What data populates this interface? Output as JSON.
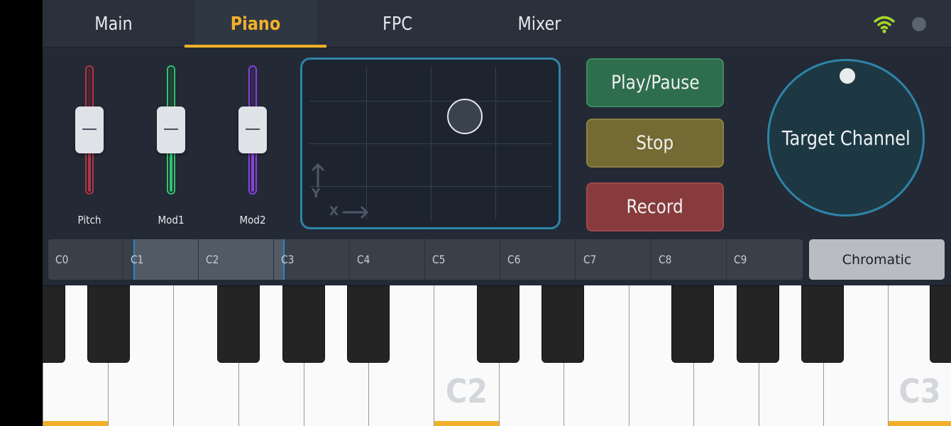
{
  "tabs": [
    {
      "label": "Main",
      "active": false
    },
    {
      "label": "Piano",
      "active": true
    },
    {
      "label": "FPC",
      "active": false
    },
    {
      "label": "Mixer",
      "active": false
    }
  ],
  "status": {
    "wifi_icon": "wifi-icon",
    "wifi_color": "#a6d629",
    "indicator_color": "#5b6270"
  },
  "faders": [
    {
      "label": "Pitch",
      "color": "#b53344",
      "level": 0.5
    },
    {
      "label": "Mod1",
      "color": "#2ec46d",
      "level": 0.5
    },
    {
      "label": "Mod2",
      "color": "#8a3fe0",
      "level": 0.5
    }
  ],
  "xypad": {
    "x_label": "X",
    "y_label": "Y",
    "puck_x": 0.63,
    "puck_y": 0.68
  },
  "transport": {
    "play_label": "Play/Pause",
    "stop_label": "Stop",
    "record_label": "Record"
  },
  "knob": {
    "label": "Target Channel"
  },
  "octaves": [
    "C0",
    "C1",
    "C2",
    "C3",
    "C4",
    "C5",
    "C6",
    "C7",
    "C8",
    "C9"
  ],
  "octave_range": {
    "start": "C1",
    "end": "C3"
  },
  "scale_button": {
    "label": "Chromatic"
  },
  "keyboard": {
    "visible_labels": [
      "C2",
      "C3"
    ],
    "accent_color": "#f2b02a"
  }
}
